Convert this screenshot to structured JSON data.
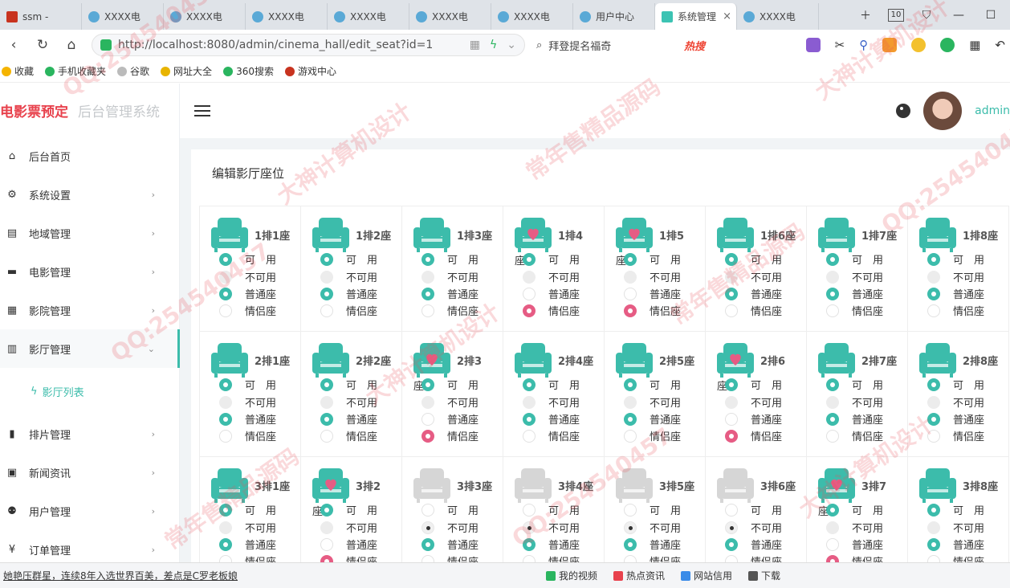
{
  "browser": {
    "tabs": [
      {
        "label": "ssm - ",
        "icon": "red"
      },
      {
        "label": "XXXX电",
        "icon": "blue"
      },
      {
        "label": "XXXX电",
        "icon": "blue"
      },
      {
        "label": "XXXX电",
        "icon": "blue"
      },
      {
        "label": "XXXX电",
        "icon": "blue"
      },
      {
        "label": "XXXX电",
        "icon": "blue"
      },
      {
        "label": "XXXX电",
        "icon": "blue"
      },
      {
        "label": "用户中心",
        "icon": "blue"
      },
      {
        "label": "系统管理",
        "icon": "green",
        "active": true
      },
      {
        "label": "XXXX电",
        "icon": "blue"
      }
    ],
    "tab_count": "10",
    "url": "http://localhost:8080/admin/cinema_hall/edit_seat?id=1",
    "search_text": "拜登提名福奇",
    "search_hot": "热搜",
    "bookmarks": [
      "收藏",
      "手机收藏夹",
      "谷歌",
      "网址大全",
      "360搜索",
      "游戏中心"
    ]
  },
  "app": {
    "brand_main": "电影票预定",
    "brand_sub": "后台管理系统",
    "username": "admin",
    "page_title": "编辑影厅座位"
  },
  "menu": [
    {
      "label": "后台首页",
      "icon": "home-icon",
      "glyph": "⌂",
      "arrow": false
    },
    {
      "label": "系统设置",
      "icon": "gear-icon",
      "glyph": "⚙",
      "arrow": true
    },
    {
      "label": "地域管理",
      "icon": "map-icon",
      "glyph": "▤",
      "arrow": true
    },
    {
      "label": "电影管理",
      "icon": "film-icon",
      "glyph": "▬",
      "arrow": true
    },
    {
      "label": "影院管理",
      "icon": "store-icon",
      "glyph": "▦",
      "arrow": true
    },
    {
      "label": "影厅管理",
      "icon": "building-icon",
      "glyph": "▥",
      "arrow": true,
      "open": true
    }
  ],
  "submenu": {
    "label": "影厅列表",
    "icon": "bolt-icon",
    "glyph": "ϟ"
  },
  "menu_after": [
    {
      "label": "排片管理",
      "icon": "schedule-icon",
      "glyph": "▮",
      "arrow": true
    },
    {
      "label": "新闻资讯",
      "icon": "news-icon",
      "glyph": "▣",
      "arrow": true
    },
    {
      "label": "用户管理",
      "icon": "users-icon",
      "glyph": "⚉",
      "arrow": true
    },
    {
      "label": "订单管理",
      "icon": "yen-icon",
      "glyph": "¥",
      "arrow": true
    }
  ],
  "options": {
    "available": "可　用",
    "unavailable": "不可用",
    "normal": "普通座",
    "couple": "情侣座",
    "couple_prefix": "座"
  },
  "seats": [
    {
      "label": "1排1座",
      "type": "normal",
      "available": true
    },
    {
      "label": "1排2座",
      "type": "normal",
      "available": true
    },
    {
      "label": "1排3座",
      "type": "normal",
      "available": true
    },
    {
      "label": "1排4",
      "type": "couple",
      "available": true
    },
    {
      "label": "1排5",
      "type": "couple",
      "available": true
    },
    {
      "label": "1排6座",
      "type": "normal",
      "available": true
    },
    {
      "label": "1排7座",
      "type": "normal",
      "available": true
    },
    {
      "label": "1排8座",
      "type": "normal",
      "available": true
    },
    {
      "label": "2排1座",
      "type": "normal",
      "available": true
    },
    {
      "label": "2排2座",
      "type": "normal",
      "available": true
    },
    {
      "label": "2排3",
      "type": "couple",
      "available": true
    },
    {
      "label": "2排4座",
      "type": "normal",
      "available": true
    },
    {
      "label": "2排5座",
      "type": "normal",
      "available": true
    },
    {
      "label": "2排6",
      "type": "couple",
      "available": true
    },
    {
      "label": "2排7座",
      "type": "normal",
      "available": true
    },
    {
      "label": "2排8座",
      "type": "normal",
      "available": true
    },
    {
      "label": "3排1座",
      "type": "normal",
      "available": true
    },
    {
      "label": "3排2",
      "type": "couple",
      "available": true
    },
    {
      "label": "3排3座",
      "type": "normal",
      "available": false
    },
    {
      "label": "3排4座",
      "type": "normal",
      "available": false
    },
    {
      "label": "3排5座",
      "type": "normal",
      "available": false
    },
    {
      "label": "3排6座",
      "type": "normal",
      "available": false
    },
    {
      "label": "3排7",
      "type": "couple",
      "available": true
    },
    {
      "label": "3排8座",
      "type": "normal",
      "available": true
    }
  ],
  "statusbar": {
    "news": "她艳压群星，连续8年入选世界百美，差点是C罗老板娘",
    "items": [
      "我的视频",
      "热点资讯",
      "网站信用",
      "下载"
    ]
  },
  "colors": {
    "accent": "#3cbcab",
    "couple": "#e65c84",
    "brand": "#e8424d",
    "disabled": "#d6d6d6"
  }
}
